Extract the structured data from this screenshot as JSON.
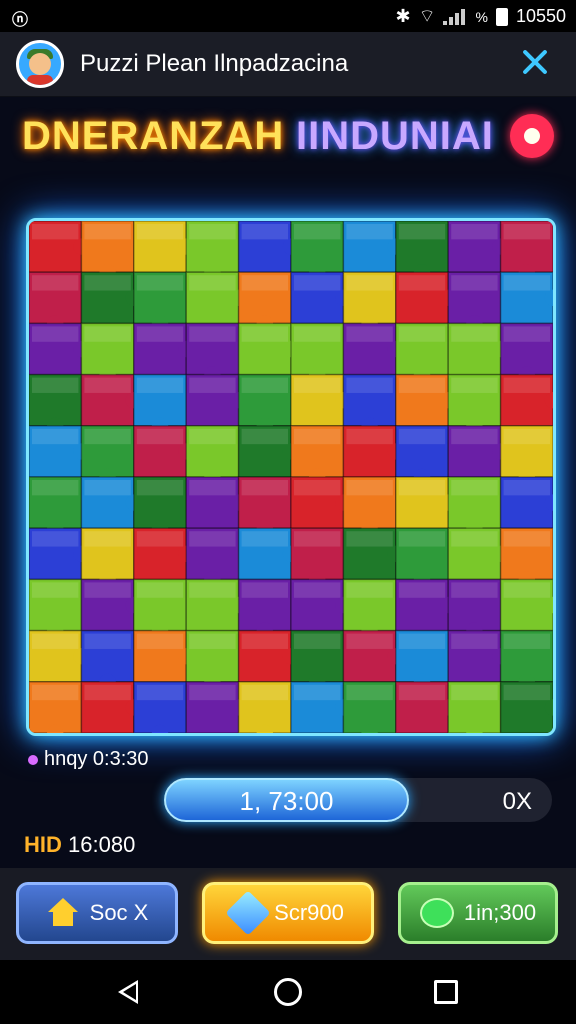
{
  "status_bar": {
    "left_icon": "n-notification-icon",
    "time": "10550",
    "icons": [
      "bluetooth-icon",
      "wifi-icon",
      "signal-icon",
      "battery-icon"
    ],
    "battery_text": "%"
  },
  "header": {
    "title": "Puzzi Plean Ilnpadzacina",
    "avatar_icon": "character-avatar-icon",
    "close_icon": "close-icon"
  },
  "banner": {
    "part1": "DNERANZAH",
    "part2": "IINDUNIAI",
    "badge_icon": "red-gem-badge-icon"
  },
  "board": {
    "rows": 10,
    "cols": 10,
    "colors": [
      "#d8232a",
      "#1f7a2a",
      "#2c3fd6",
      "#f0791c",
      "#6a1fa6",
      "#2e9b3a",
      "#e0c41d",
      "#c01f4a",
      "#1b8bd8",
      "#7ac82a"
    ]
  },
  "timer": {
    "label": "hnqy 0:3:30"
  },
  "progress": {
    "value_text": "1, 73:00",
    "fraction": 0.62,
    "multiplier": "0X"
  },
  "best": {
    "tag": "HID",
    "value": "16:080"
  },
  "buttons": [
    {
      "label": "Soc X",
      "icon": "house-icon"
    },
    {
      "label": "Scr900",
      "icon": "gem-icon"
    },
    {
      "label": "1in;300",
      "icon": "green-blob-icon"
    }
  ],
  "nav": {
    "back_icon": "back-icon",
    "home_icon": "home-icon",
    "recent_icon": "recent-apps-icon"
  }
}
